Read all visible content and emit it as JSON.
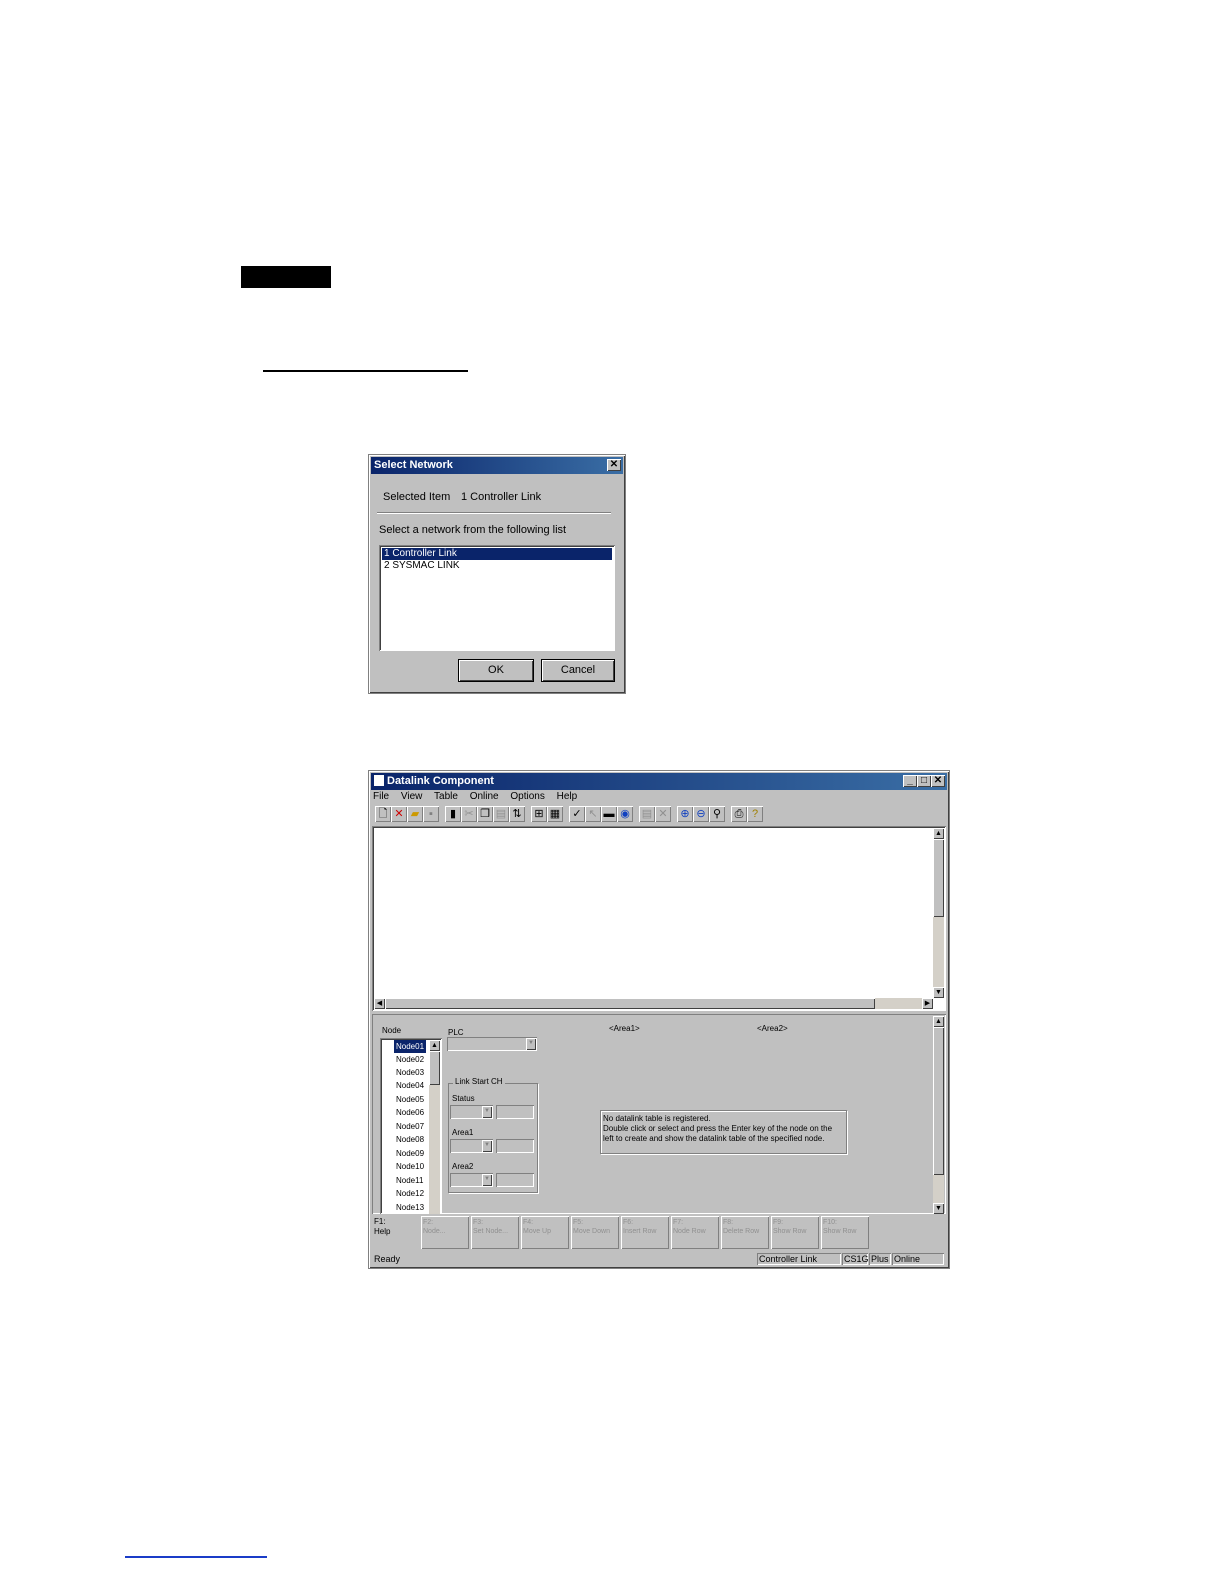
{
  "select_network": {
    "title": "Select Network",
    "selected_item_label": "Selected Item",
    "selected_item_value": "1 Controller Link",
    "instruction": "Select a network from the following list",
    "options": [
      "1 Controller Link",
      "2 SYSMAC LINK"
    ],
    "ok_label": "OK",
    "cancel_label": "Cancel"
  },
  "app": {
    "title": "Datalink Component",
    "menu": [
      "File",
      "View",
      "Table",
      "Online",
      "Options",
      "Help"
    ],
    "node_label": "Node",
    "plc_label": "PLC",
    "area1_header": "<Area1>",
    "area2_header": "<Area2>",
    "nodes": [
      "Node01",
      "Node02",
      "Node03",
      "Node04",
      "Node05",
      "Node06",
      "Node07",
      "Node08",
      "Node09",
      "Node10",
      "Node11",
      "Node12",
      "Node13"
    ],
    "link_start_label": "Link Start CH",
    "status_label": "Status",
    "area1_label": "Area1",
    "area2_label": "Area2",
    "message_line1": "No datalink table is registered.",
    "message_line2": "Double click or select and press the Enter key of the node on the",
    "message_line3": "left to create and show the datalink table of the specified node.",
    "fkeys": [
      {
        "key": "F1:",
        "label": "Help"
      },
      {
        "key": "F2:",
        "label": "Node..."
      },
      {
        "key": "F3:",
        "label": "Set Node..."
      },
      {
        "key": "F4:",
        "label": "Move Up"
      },
      {
        "key": "F5:",
        "label": "Move Down"
      },
      {
        "key": "F6:",
        "label": "Insert Row"
      },
      {
        "key": "F7:",
        "label": "Node Row"
      },
      {
        "key": "F8:",
        "label": "Delete Row"
      },
      {
        "key": "F9:",
        "label": "Show Row"
      },
      {
        "key": "F10:",
        "label": "Show Row"
      }
    ],
    "status_ready": "Ready",
    "status_network": "Controller Link",
    "status_plc": "CS1G",
    "status_mode": "Plus",
    "status_online": "Online"
  }
}
